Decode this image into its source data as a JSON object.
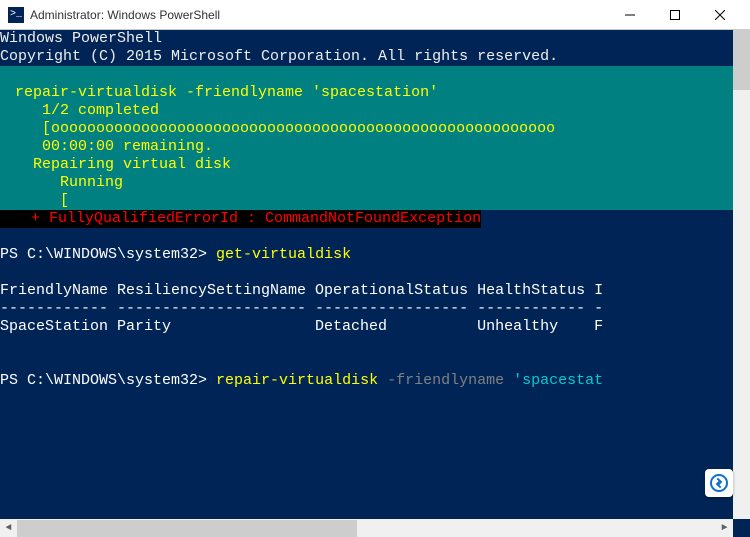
{
  "window": {
    "title": "Administrator: Windows PowerShell",
    "icon_label": ">_"
  },
  "header": {
    "line1": "Windows PowerShell",
    "line2": "Copyright (C) 2015 Microsoft Corporation. All rights reserved."
  },
  "progress_block": {
    "cmd": " repair-virtualdisk -friendlyname 'spacestation'",
    "progress1": "    1/2 completed",
    "progress2": "    [oooooooooooooooooooooooooooooooooooooooooooooooooooooooo",
    "remaining": "    00:00:00 remaining.",
    "action": "   Repairing virtual disk",
    "status": "      Running",
    "bracket": "      ["
  },
  "error": {
    "text": "   + FullyQualifiedErrorId : CommandNotFoundException"
  },
  "prompt1": {
    "prefix": "PS C:\\WINDOWS\\system32> ",
    "command": "get-virtualdisk"
  },
  "table": {
    "header": "FriendlyName ResiliencySettingName OperationalStatus HealthStatus I",
    "divider": "------------ --------------------- ----------------- ------------ -",
    "row": "SpaceStation Parity                Detached          Unhealthy    F"
  },
  "prompt2": {
    "prefix": "PS C:\\WINDOWS\\system32> ",
    "command": "repair-virtualdisk",
    "param": " -friendlyname ",
    "arg": "'spacestat"
  }
}
